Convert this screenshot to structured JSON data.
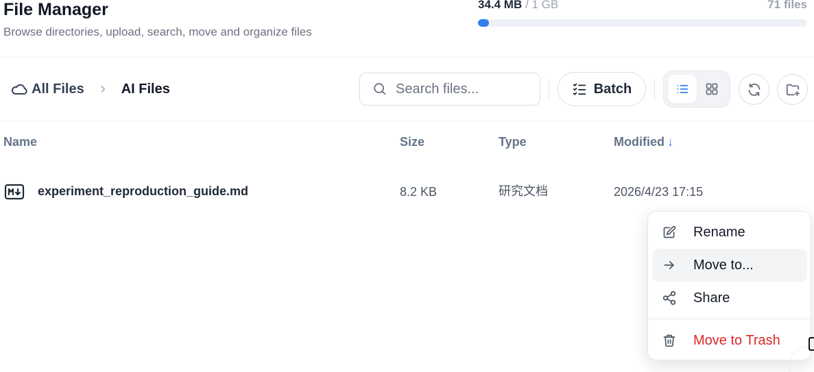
{
  "header": {
    "title": "File Manager",
    "subtitle": "Browse directories, upload, search, move and organize files"
  },
  "storage": {
    "used": "34.4 MB",
    "separator": "/",
    "total": "1 GB",
    "file_count": "71 files",
    "used_fraction": 0.034
  },
  "breadcrumb": {
    "root_icon": "cloud-icon",
    "root_label": "All Files",
    "separator_icon": "chevron-right-icon",
    "current_label": "AI Files"
  },
  "toolbar": {
    "search_placeholder": "Search files...",
    "batch_label": "Batch",
    "view_mode": "list",
    "accent_color": "#2f80ed"
  },
  "table": {
    "columns": [
      "Name",
      "Size",
      "Type",
      "Modified"
    ],
    "sort_column": "Modified",
    "sort_indicator": "↓",
    "rows": [
      {
        "icon": "markdown-file-icon",
        "name": "experiment_reproduction_guide.md",
        "size": "8.2 KB",
        "type": "研究文档",
        "modified": "2026/4/23 17:15"
      }
    ]
  },
  "context_menu": {
    "items": [
      {
        "label": "Rename",
        "icon": "pencil-edit-icon"
      },
      {
        "label": "Move to...",
        "icon": "arrow-right-icon"
      },
      {
        "label": "Share",
        "icon": "share-icon"
      },
      {
        "label": "Move to Trash",
        "icon": "trash-icon"
      }
    ],
    "hovered": "Move to...",
    "danger_color": "#dc2626"
  }
}
